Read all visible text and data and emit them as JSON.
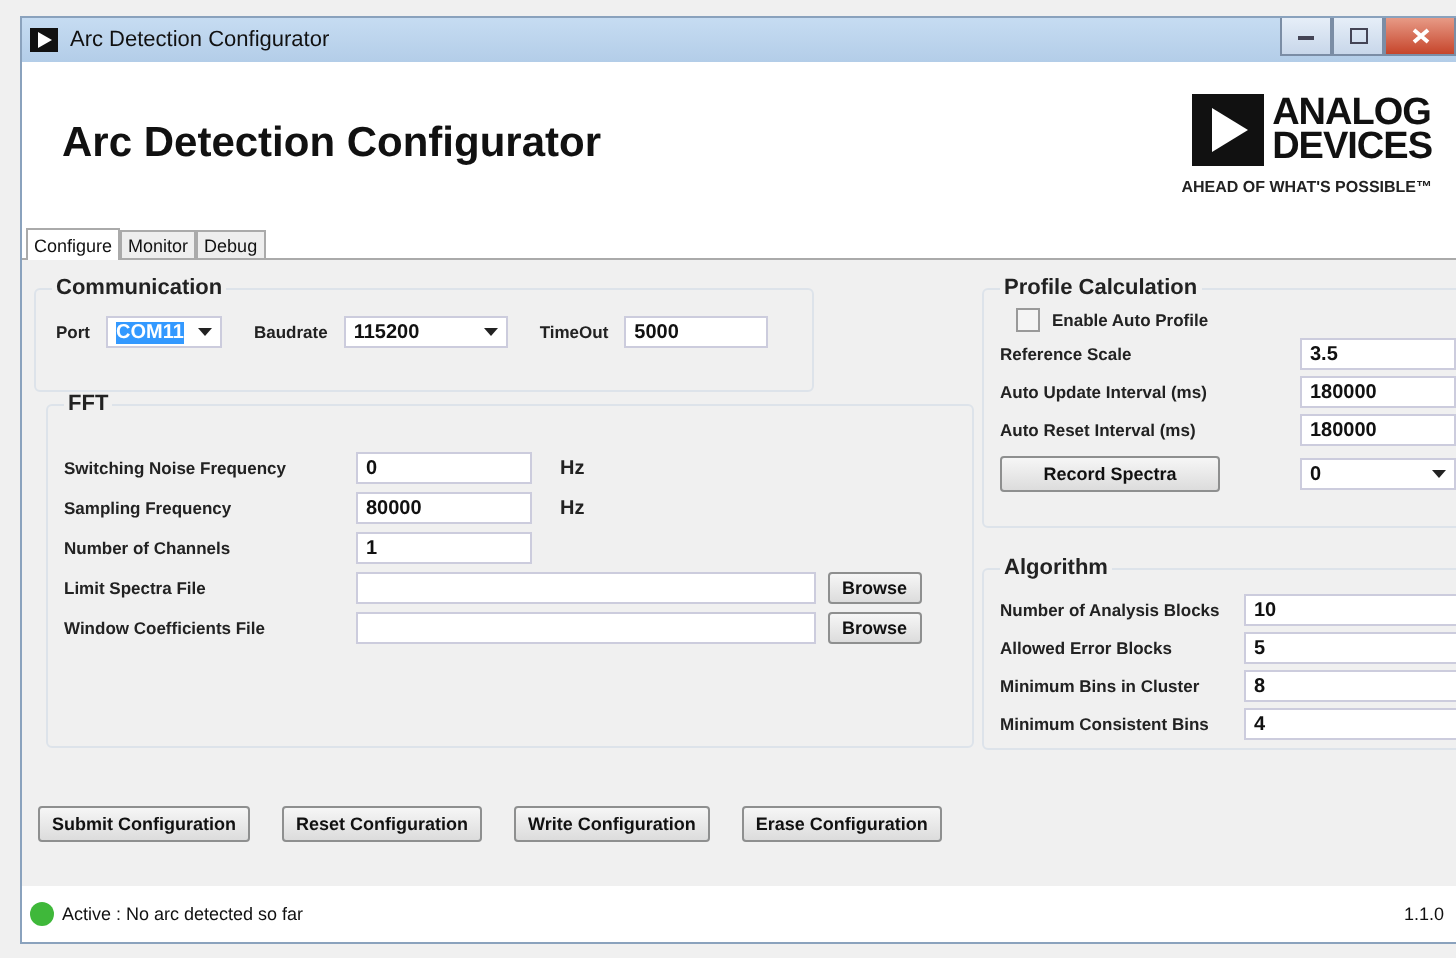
{
  "window": {
    "title": "Arc Detection Configurator"
  },
  "header": {
    "title": "Arc Detection Configurator",
    "logo_lines": [
      "ANALOG",
      "DEVICES"
    ],
    "tagline": "AHEAD OF WHAT'S POSSIBLE™"
  },
  "tabs": [
    {
      "label": "Configure",
      "selected": true
    },
    {
      "label": "Monitor",
      "selected": false
    },
    {
      "label": "Debug",
      "selected": false
    }
  ],
  "communication": {
    "title": "Communication",
    "fields": [
      {
        "label": "Port",
        "value": "COM11",
        "kind": "dropdown",
        "text_selected": true
      },
      {
        "label": "Baudrate",
        "value": "115200",
        "kind": "dropdown",
        "text_selected": false
      },
      {
        "label": "TimeOut",
        "value": "5000",
        "kind": "text",
        "text_selected": false
      }
    ]
  },
  "fft": {
    "title": "FFT",
    "rows": [
      {
        "label": "Switching Noise Frequency",
        "value": "0",
        "kind": "text",
        "unit": "Hz"
      },
      {
        "label": "Sampling  Frequency",
        "value": "80000",
        "kind": "text",
        "unit": "Hz"
      },
      {
        "label": "Number of Channels",
        "value": "1",
        "kind": "text"
      },
      {
        "label": "Limit Spectra File",
        "kind": "file",
        "button": "Browse"
      },
      {
        "label": "Window Coefficients File",
        "kind": "file",
        "button": "Browse"
      }
    ]
  },
  "profile": {
    "title": "Profile Calculation",
    "checkbox": {
      "label": "Enable Auto Profile",
      "checked": false
    },
    "rows": [
      {
        "label": "Reference Scale",
        "value": "3.5"
      },
      {
        "label": "Auto Update Interval (ms)",
        "value": "180000"
      },
      {
        "label": "Auto Reset Interval (ms)",
        "value": "180000"
      }
    ],
    "button": "Record Spectra",
    "dropdown_value": "0"
  },
  "algorithm": {
    "title": "Algorithm",
    "rows": [
      {
        "label": "Number of Analysis Blocks",
        "value": "10"
      },
      {
        "label": "Allowed Error Blocks",
        "value": "5"
      },
      {
        "label": "Minimum Bins in Cluster",
        "value": "8"
      },
      {
        "label": "Minimum Consistent  Bins",
        "value": "4"
      }
    ]
  },
  "buttons": [
    "Submit Configuration",
    "Reset Configuration",
    "Write  Configuration",
    "Erase Configuration"
  ],
  "status_bar": {
    "indicator": {
      "color": "#3fb83a"
    },
    "text": "Active : No arc detected so far",
    "version": "1.1.0"
  }
}
